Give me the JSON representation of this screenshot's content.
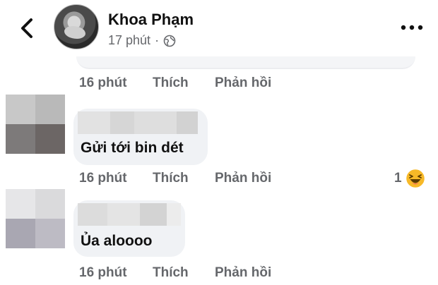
{
  "header": {
    "name": "Khoa Phạm",
    "time": "17 phút",
    "separator": "·"
  },
  "comments": [
    {
      "time": "16 phút",
      "like": "Thích",
      "reply": "Phản hồi"
    },
    {
      "time": "16 phút",
      "like": "Thích",
      "reply": "Phản hồi",
      "text": "Gửi tới bin dét",
      "reaction_count": "1"
    },
    {
      "time": "16 phút",
      "like": "Thích",
      "reply": "Phản hồi",
      "text": "Ủa aloooo"
    }
  ],
  "icons": {
    "back": "chevron-left-icon",
    "more": "more-horizontal-icon",
    "privacy": "globe-icon",
    "reaction": "haha-emoji-icon"
  },
  "colors": {
    "text_primary": "#111111",
    "text_secondary": "#65676b",
    "bubble": "#f0f2f5",
    "emoji": "#f7b928"
  }
}
